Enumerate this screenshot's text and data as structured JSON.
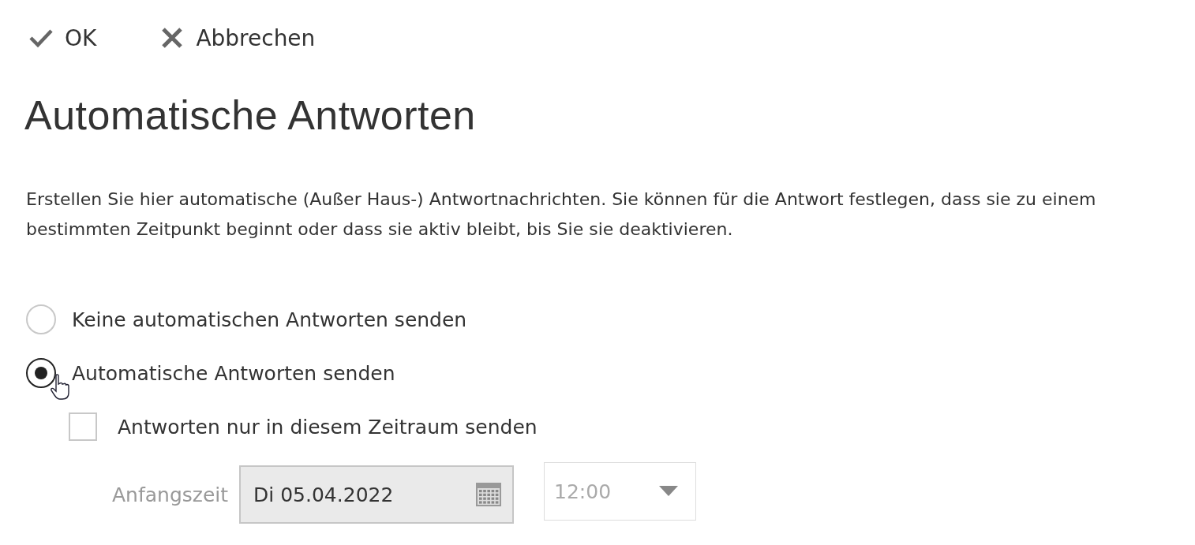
{
  "toolbar": [
    {
      "kind": "ok",
      "label": "OK"
    },
    {
      "kind": "cancel",
      "label": "Abbrechen"
    }
  ],
  "title": "Automatische Antworten",
  "description": "Erstellen Sie hier automatische (Außer Haus-) Antwortnachrichten. Sie können für die Antwort festlegen, dass sie zu einem bestimmten Zeitpunkt beginnt oder dass sie aktiv bleibt, bis Sie sie deaktivieren.",
  "reply_options": [
    {
      "label": "Keine automatischen Antworten senden",
      "selected": false
    },
    {
      "label": "Automatische Antworten senden",
      "selected": true
    }
  ],
  "period_checkbox": {
    "label": "Antworten nur in diesem Zeitraum senden",
    "checked": false
  },
  "start_time": {
    "label": "Anfangszeit",
    "date": "Di 05.04.2022",
    "time": "12:00",
    "time_disabled": true
  }
}
